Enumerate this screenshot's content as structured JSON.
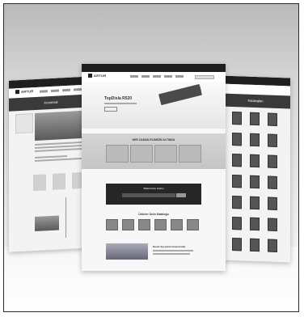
{
  "center": {
    "logo_text": "ARTUR",
    "hero_title": "TopDisla R520",
    "section1_title": "HER ZAMAN ELİMİZİN ALTINDA",
    "newsletter_title": "Bültenimize Katılın",
    "products_title": "Ürünler Ürün Kataloğu",
    "news_title": "Duvar tipi panel tasarımında"
  },
  "left": {
    "logo_text": "ARTUR",
    "banner_title": "Kurumsal"
  },
  "right": {
    "banner_title": "Katalogları"
  }
}
